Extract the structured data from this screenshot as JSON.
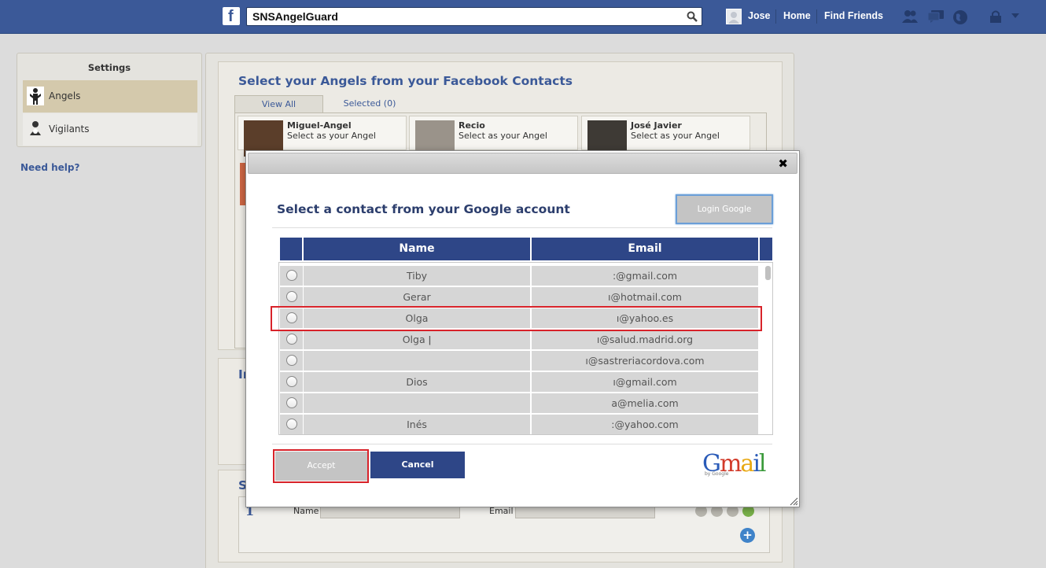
{
  "topbar": {
    "search_value": "SNSAngelGuard",
    "user_name": "Jose",
    "home": "Home",
    "find_friends": "Find Friends"
  },
  "settings": {
    "title": "Settings",
    "items": [
      {
        "label": "Angels",
        "icon": "angel-icon"
      },
      {
        "label": "Vigilants",
        "icon": "vigilant-icon"
      }
    ],
    "need_help": "Need help?"
  },
  "main": {
    "section_title": "Select your Angels from your Facebook Contacts",
    "tabs": [
      {
        "label": "View All"
      },
      {
        "label": "Selected (0)"
      }
    ],
    "cards": [
      {
        "name": "Miguel-Angel",
        "action": "Select as your Angel"
      },
      {
        "name": "Recio",
        "action": "Select as your Angel"
      },
      {
        "name": "José Javier",
        "action": "Select as your Angel"
      }
    ],
    "section2_title": "In",
    "section3_title": "S",
    "row": {
      "number": "1",
      "name_label": "Name",
      "email_label": "Email"
    }
  },
  "modal": {
    "title": "Select a contact from your Google account",
    "login_button": "Login Google",
    "columns": [
      "Name",
      "Email"
    ],
    "rows": [
      {
        "name": "Tiby",
        "email": ":@gmail.com"
      },
      {
        "name": "Gerar",
        "email": "ı@hotmail.com"
      },
      {
        "name": "Olga",
        "email": "ı@yahoo.es"
      },
      {
        "name": "Olga ǀ",
        "email": "ı@salud.madrid.org"
      },
      {
        "name": "",
        "email": "ı@sastreriacordova.com"
      },
      {
        "name": "Dios",
        "email": "ı@gmail.com"
      },
      {
        "name": "",
        "email": "a@melia.com"
      },
      {
        "name": "Inés",
        "email": ":@yahoo.com"
      }
    ],
    "accept_button": "Accept",
    "cancel_button": "Cancel",
    "gmail_logo": "Gmail",
    "gmail_byline": "by Google"
  },
  "colors": {
    "facebook_blue": "#3b5998",
    "table_header": "#2e4687",
    "highlight_red": "#d8232a"
  }
}
